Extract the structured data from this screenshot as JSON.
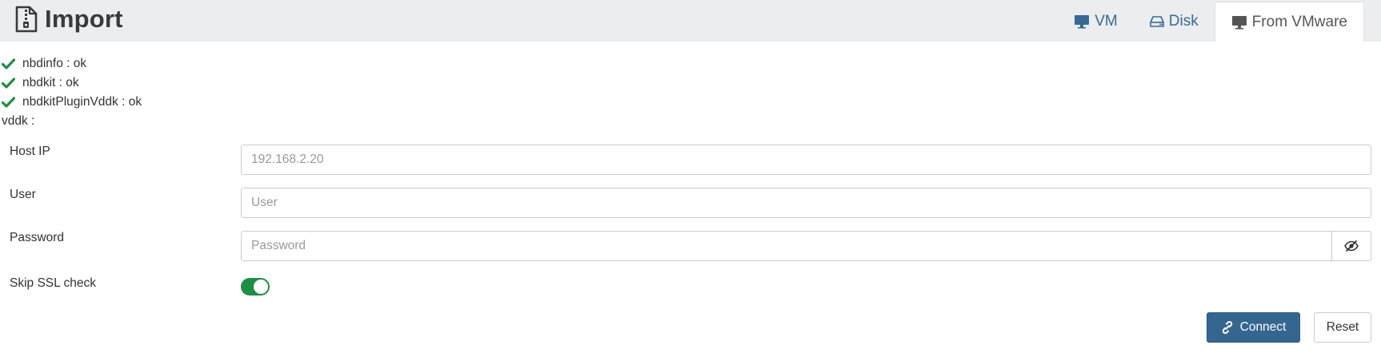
{
  "header": {
    "title": "Import",
    "title_icon": "file-zip-icon",
    "tabs": [
      {
        "label": "VM",
        "icon": "monitor-icon",
        "active": false
      },
      {
        "label": "Disk",
        "icon": "hdd-icon",
        "active": false
      },
      {
        "label": "From VMware",
        "icon": "monitor-icon",
        "active": true
      }
    ]
  },
  "status": [
    {
      "text": "nbdinfo : ok",
      "icon": "check-icon"
    },
    {
      "text": "nbdkit : ok",
      "icon": "check-icon"
    },
    {
      "text": "nbdkitPluginVddk : ok",
      "icon": "check-icon"
    }
  ],
  "vddk_text": "vddk :",
  "form": {
    "host_ip": {
      "label": "Host IP",
      "value": "",
      "placeholder": "192.168.2.20"
    },
    "user": {
      "label": "User",
      "value": "",
      "placeholder": "User"
    },
    "password": {
      "label": "Password",
      "value": "",
      "placeholder": "Password",
      "toggle_icon": "eye-slash-icon"
    },
    "skip_ssl": {
      "label": "Skip SSL check",
      "checked": true
    }
  },
  "actions": {
    "connect_label": "Connect",
    "connect_icon": "link-icon",
    "reset_label": "Reset"
  },
  "colors": {
    "header_bg": "#ebedef",
    "tab_link": "#3a6994",
    "check_green": "#1e8e44",
    "primary": "#35668f"
  }
}
